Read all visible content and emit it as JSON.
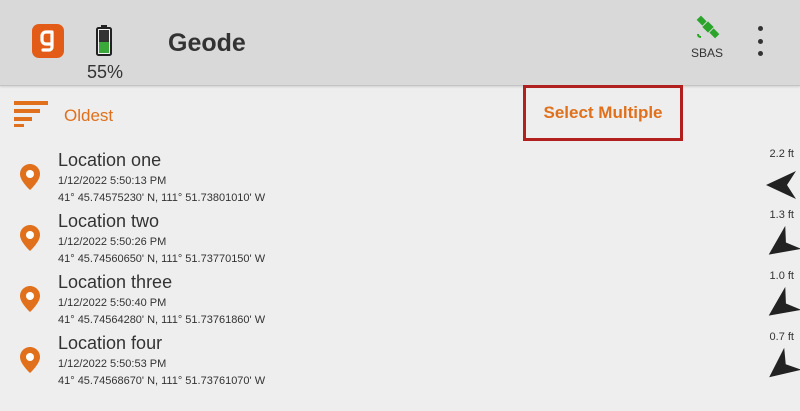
{
  "header": {
    "logo_icon": "geode-app-logo-icon",
    "logo_letter": "g",
    "battery_icon": "battery-icon",
    "battery_percent": "55%",
    "title": "Geode",
    "sbas_icon": "satellite-icon",
    "sbas_label": "SBAS",
    "menu_icon": "more-vert-icon"
  },
  "toolbar": {
    "sort_icon": "sort-icon",
    "sort_label": "Oldest",
    "select_multiple_label": "Select Multiple"
  },
  "colors": {
    "accent": "#e0701b",
    "highlight_border": "#b21f1f",
    "satellite": "#2aa52a",
    "battery_fill": "#3aa93a"
  },
  "locations": [
    {
      "name": "Location one",
      "timestamp": "1/12/2022 5:50:13 PM",
      "coordinates": "41° 45.74575230' N, 111° 51.73801010' W",
      "distance": "2.2 ft",
      "direction_icon": "direction-arrow-icon"
    },
    {
      "name": "Location two",
      "timestamp": "1/12/2022 5:50:26 PM",
      "coordinates": "41° 45.74560650' N, 111° 51.73770150' W",
      "distance": "1.3 ft",
      "direction_icon": "direction-arrow-icon"
    },
    {
      "name": "Location three",
      "timestamp": "1/12/2022 5:50:40 PM",
      "coordinates": "41° 45.74564280' N, 111° 51.73761860' W",
      "distance": "1.0 ft",
      "direction_icon": "direction-arrow-icon"
    },
    {
      "name": "Location four",
      "timestamp": "1/12/2022 5:50:53 PM",
      "coordinates": "41° 45.74568670' N, 111° 51.73761070' W",
      "distance": "0.7 ft",
      "direction_icon": "direction-arrow-icon"
    }
  ]
}
